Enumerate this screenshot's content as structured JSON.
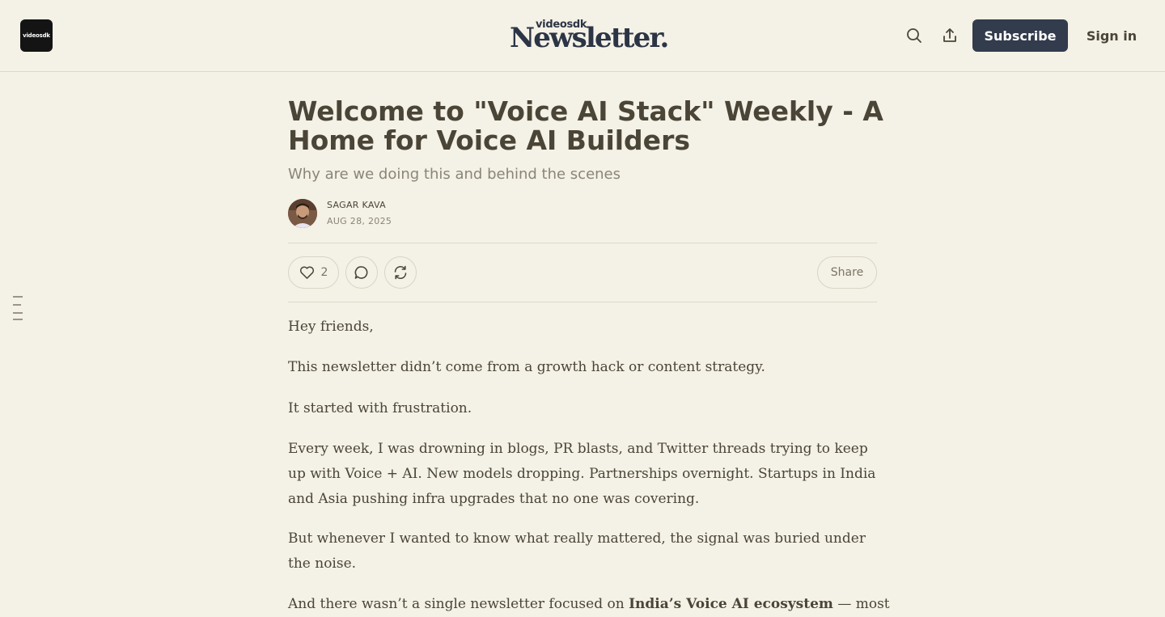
{
  "header": {
    "logo_text": "videosdk",
    "masthead_small": "videosdk",
    "masthead_big": "Newsletter.",
    "subscribe_label": "Subscribe",
    "signin_label": "Sign in"
  },
  "article": {
    "title": "Welcome to \"Voice AI Stack\" Weekly - A Home for Voice AI Builders",
    "subtitle": "Why are we doing this and behind the scenes",
    "author": "SAGAR KAVA",
    "date": "AUG 28, 2025",
    "like_count": "2",
    "share_label": "Share",
    "paragraphs": [
      "Hey friends,",
      "This newsletter didn’t come from a growth hack or content strategy.",
      "It started with frustration.",
      "Every week, I was drowning in blogs, PR blasts, and Twitter threads trying to keep up with Voice + AI. New models dropping. Partnerships overnight. Startups in India and Asia pushing infra upgrades that no one was covering.",
      "But whenever I wanted to know what really mattered, the signal was buried under the noise."
    ],
    "last_paragraph": {
      "before": "And there wasn’t a single newsletter focused on ",
      "bold": "India’s Voice AI ecosystem",
      "after": " — most"
    }
  },
  "colors": {
    "background": "#f4f1e6",
    "subscribe_bg": "#323c4d",
    "text": "#4a4536",
    "muted": "#8a8577"
  },
  "icons": {
    "header": [
      "search-icon",
      "share-upload-icon"
    ],
    "actions": [
      "heart-icon",
      "comment-icon",
      "restack-icon"
    ],
    "side": "table-of-contents-icon"
  }
}
